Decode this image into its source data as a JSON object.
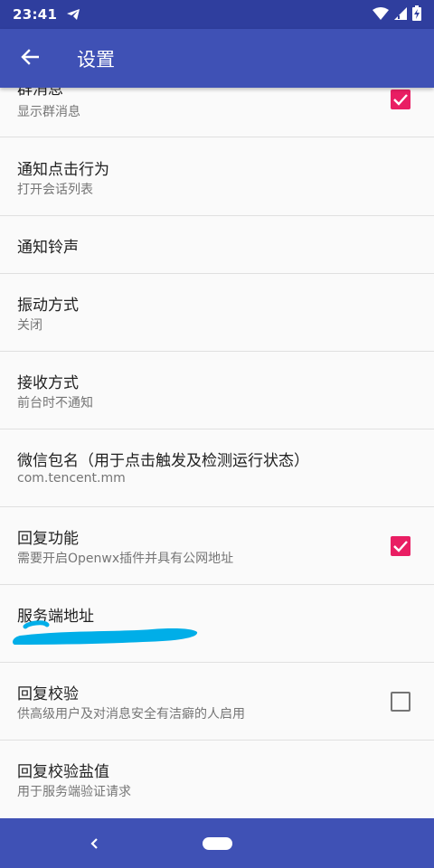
{
  "status_bar": {
    "time": "23:41",
    "icons": [
      "telegram-send-icon",
      "wifi-icon",
      "cellular-signal-icon",
      "battery-charging-icon"
    ]
  },
  "app_bar": {
    "back_icon": "arrow-left-icon",
    "title": "设置"
  },
  "preferences": [
    {
      "title": "群消息",
      "summary": "显示群消息",
      "checkbox": "checked"
    },
    {
      "title": "通知点击行为",
      "summary": "打开会话列表"
    },
    {
      "title": "通知铃声"
    },
    {
      "title": "振动方式",
      "summary": "关闭"
    },
    {
      "title": "接收方式",
      "summary": "前台时不通知"
    },
    {
      "title": "微信包名（用于点击触发及检测运行状态）",
      "summary": "com.tencent.mm"
    },
    {
      "title": "回复功能",
      "summary": "需要开启Openwx插件并具有公网地址",
      "checkbox": "checked"
    },
    {
      "title": "服务端地址",
      "summary_redacted": true
    },
    {
      "title": "回复校验",
      "summary": "供高级用户及对消息安全有洁癖的人启用",
      "checkbox": "unchecked"
    },
    {
      "title": "回复校验盐值",
      "summary": "用于服务端验证请求"
    }
  ],
  "colors": {
    "primary": "#3f51b5",
    "primary_dark": "#2f3e9e",
    "accent": "#e91e63",
    "divider": "#e0e0e0",
    "redaction": "#00aee8"
  },
  "nav_bar": {
    "back_icon": "nav-back-chevron-icon",
    "home_icon": "home-pill-icon"
  }
}
